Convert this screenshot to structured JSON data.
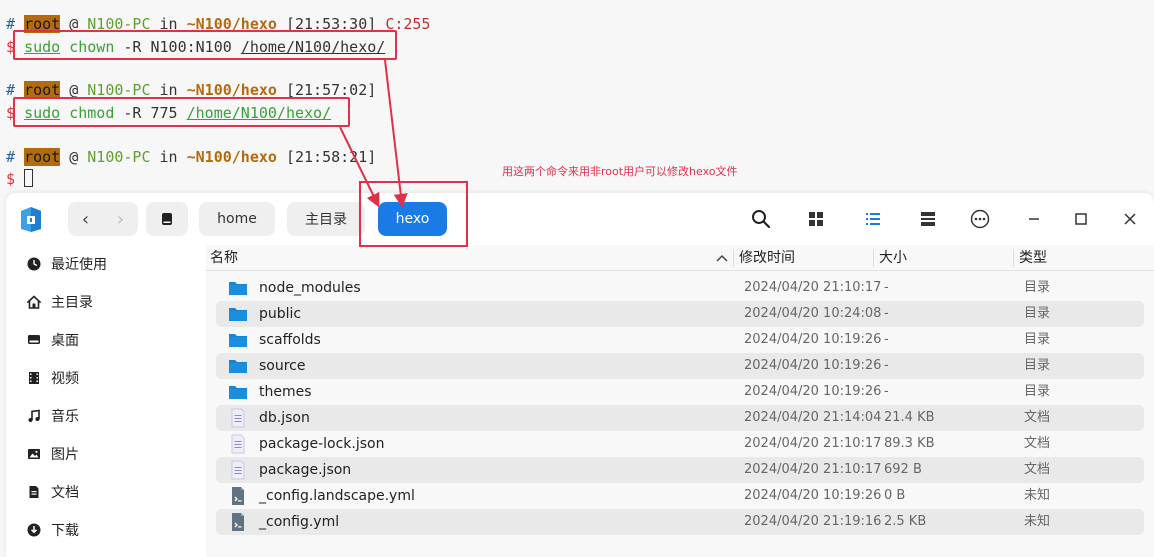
{
  "terminal": {
    "prompts": [
      {
        "hash": "#",
        "user": "root",
        "at": "@",
        "host": "N100-PC",
        "in": "in",
        "path": "~N100/hexo",
        "time": "[21:53:30]",
        "code": "C:255"
      },
      {
        "hash": "#",
        "user": "root",
        "at": "@",
        "host": "N100-PC",
        "in": "in",
        "path": "~N100/hexo",
        "time": "[21:57:02]",
        "code": ""
      },
      {
        "hash": "#",
        "user": "root",
        "at": "@",
        "host": "N100-PC",
        "in": "in",
        "path": "~N100/hexo",
        "time": "[21:58:21]",
        "code": ""
      }
    ],
    "commands": [
      {
        "dollar": "$",
        "sudo": "sudo",
        "cmd": "chown",
        "args": "-R N100:N100",
        "dir": "/home/N100/hexo/"
      },
      {
        "dollar": "$",
        "sudo": "sudo",
        "cmd": "chmod",
        "args": "-R 775",
        "dir": "/home/N100/hexo/"
      }
    ],
    "last_dollar": "$",
    "annotation": "用这两个命令来用非root用户可以修改hexo文件",
    "annotation_color": "#e0304a"
  },
  "file_manager": {
    "breadcrumbs": [
      "home",
      "主目录",
      "hexo"
    ],
    "nav": {
      "back": "‹",
      "forward": "›"
    },
    "accent": "#1a7ae6",
    "sidebar": [
      {
        "label": "最近使用",
        "icon": "clock-icon"
      },
      {
        "label": "主目录",
        "icon": "home-icon"
      },
      {
        "label": "桌面",
        "icon": "desktop-icon"
      },
      {
        "label": "视频",
        "icon": "video-icon"
      },
      {
        "label": "音乐",
        "icon": "music-icon"
      },
      {
        "label": "图片",
        "icon": "picture-icon"
      },
      {
        "label": "文档",
        "icon": "document-icon"
      },
      {
        "label": "下载",
        "icon": "download-icon"
      }
    ],
    "columns": {
      "name": "名称",
      "modified": "修改时间",
      "size": "大小",
      "type": "类型"
    },
    "files": [
      {
        "name": "node_modules",
        "modified": "2024/04/20 21:10:17",
        "size": "-",
        "type": "目录",
        "kind": "folder"
      },
      {
        "name": "public",
        "modified": "2024/04/20 10:24:08",
        "size": "-",
        "type": "目录",
        "kind": "folder"
      },
      {
        "name": "scaffolds",
        "modified": "2024/04/20 10:19:26",
        "size": "-",
        "type": "目录",
        "kind": "folder"
      },
      {
        "name": "source",
        "modified": "2024/04/20 10:19:26",
        "size": "-",
        "type": "目录",
        "kind": "folder"
      },
      {
        "name": "themes",
        "modified": "2024/04/20 10:19:26",
        "size": "-",
        "type": "目录",
        "kind": "folder"
      },
      {
        "name": "db.json",
        "modified": "2024/04/20 21:14:04",
        "size": "21.4 KB",
        "type": "文档",
        "kind": "text"
      },
      {
        "name": "package-lock.json",
        "modified": "2024/04/20 21:10:17",
        "size": "89.3 KB",
        "type": "文档",
        "kind": "text"
      },
      {
        "name": "package.json",
        "modified": "2024/04/20 21:10:17",
        "size": "692 B",
        "type": "文档",
        "kind": "text"
      },
      {
        "name": "_config.landscape.yml",
        "modified": "2024/04/20 10:19:26",
        "size": "0 B",
        "type": "未知",
        "kind": "unknown"
      },
      {
        "name": "_config.yml",
        "modified": "2024/04/20 21:19:16",
        "size": "2.5 KB",
        "type": "未知",
        "kind": "unknown"
      }
    ]
  }
}
